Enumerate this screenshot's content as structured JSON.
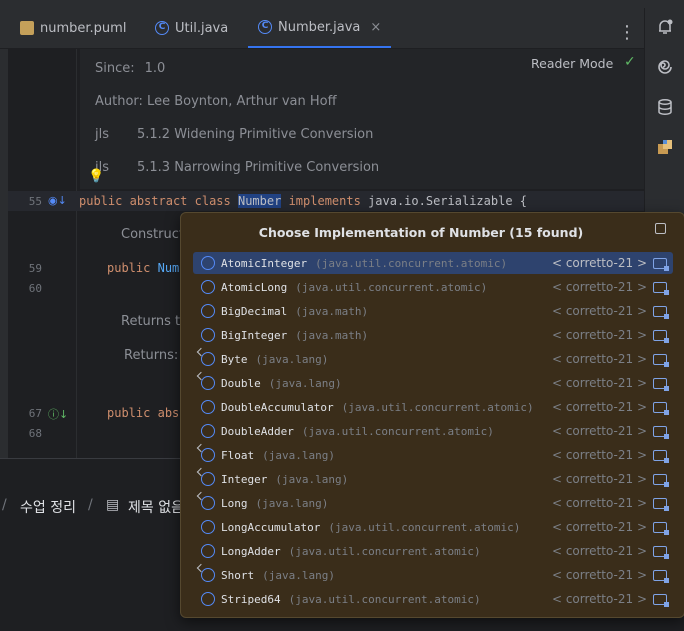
{
  "tabs": [
    {
      "label": "number.puml",
      "icon": "puml-file-icon",
      "active": false
    },
    {
      "label": "Util.java",
      "icon": "class-icon",
      "active": false
    },
    {
      "label": "Number.java",
      "icon": "class-icon",
      "active": true
    }
  ],
  "tab_close": "×",
  "more_menu": "⋮",
  "right_toolbar": [
    "notifications-icon",
    "ai-assistant-icon",
    "database-icon",
    "plugin-icon"
  ],
  "editor": {
    "reader_mode": "Reader Mode",
    "doc": {
      "since_label": "Since:",
      "since_value": "1.0",
      "author": "Author: Lee Boynton, Arthur van Hoff",
      "jls1_label": "jls",
      "jls1_value": "5.1.2 Widening Primitive Conversion",
      "jls2_label": "jls",
      "jls2_value": "5.1.3 Narrowing Primitive Conversion"
    },
    "line55": {
      "num": "55",
      "kw1": "public",
      "kw2": "abstract",
      "kw3": "class",
      "name": "Number",
      "kw4": "implements",
      "rest": "java.io.Serializable {"
    },
    "constructor_doc": "Constructo",
    "line59": {
      "num": "59",
      "kw": "public",
      "rest": "Numb"
    },
    "line60": "60",
    "returns1": "Returns th",
    "returns2": "Returns: t",
    "line67": {
      "num": "67",
      "kw": "public",
      "rest": "abst"
    },
    "line68": "68"
  },
  "breadcrumb": {
    "item1": "수업 정리",
    "sep": "/",
    "item2": "제목 없음"
  },
  "popup": {
    "title": "Choose Implementation of Number (15 found)",
    "items": [
      {
        "name": "AtomicInteger",
        "pkg": "(java.util.concurrent.atomic)",
        "lib": "< corretto-21 >",
        "final": false
      },
      {
        "name": "AtomicLong",
        "pkg": "(java.util.concurrent.atomic)",
        "lib": "< corretto-21 >",
        "final": false
      },
      {
        "name": "BigDecimal",
        "pkg": "(java.math)",
        "lib": "< corretto-21 >",
        "final": false
      },
      {
        "name": "BigInteger",
        "pkg": "(java.math)",
        "lib": "< corretto-21 >",
        "final": false
      },
      {
        "name": "Byte",
        "pkg": "(java.lang)",
        "lib": "< corretto-21 >",
        "final": true
      },
      {
        "name": "Double",
        "pkg": "(java.lang)",
        "lib": "< corretto-21 >",
        "final": true
      },
      {
        "name": "DoubleAccumulator",
        "pkg": "(java.util.concurrent.atomic)",
        "lib": "< corretto-21 >",
        "final": false
      },
      {
        "name": "DoubleAdder",
        "pkg": "(java.util.concurrent.atomic)",
        "lib": "< corretto-21 >",
        "final": false
      },
      {
        "name": "Float",
        "pkg": "(java.lang)",
        "lib": "< corretto-21 >",
        "final": true
      },
      {
        "name": "Integer",
        "pkg": "(java.lang)",
        "lib": "< corretto-21 >",
        "final": true
      },
      {
        "name": "Long",
        "pkg": "(java.lang)",
        "lib": "< corretto-21 >",
        "final": true
      },
      {
        "name": "LongAccumulator",
        "pkg": "(java.util.concurrent.atomic)",
        "lib": "< corretto-21 >",
        "final": false
      },
      {
        "name": "LongAdder",
        "pkg": "(java.util.concurrent.atomic)",
        "lib": "< corretto-21 >",
        "final": false
      },
      {
        "name": "Short",
        "pkg": "(java.lang)",
        "lib": "< corretto-21 >",
        "final": true
      },
      {
        "name": "Striped64",
        "pkg": "(java.util.concurrent.atomic)",
        "lib": "< corretto-21 >",
        "final": false
      }
    ],
    "selected_index": 0
  }
}
